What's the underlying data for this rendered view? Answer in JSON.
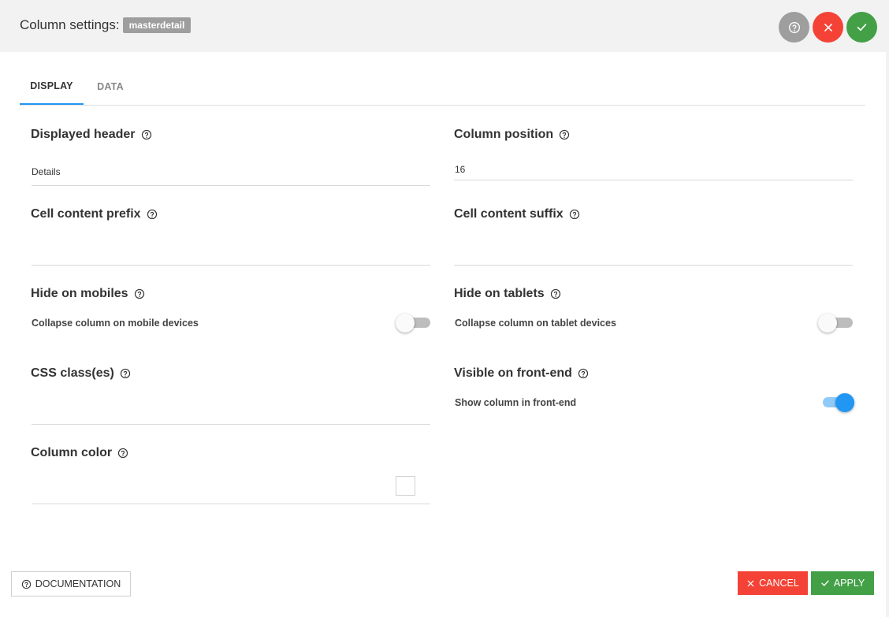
{
  "header": {
    "title": "Column settings:",
    "badge": "masterdetail",
    "help_icon": "help-circle-icon",
    "close_icon": "close-icon",
    "confirm_icon": "check-icon"
  },
  "tabs": [
    {
      "label": "DISPLAY",
      "active": true
    },
    {
      "label": "DATA",
      "active": false
    }
  ],
  "fields": {
    "displayed_header": {
      "label": "Displayed header",
      "value": "Details"
    },
    "column_position": {
      "label": "Column position",
      "value": "16"
    },
    "cell_prefix": {
      "label": "Cell content prefix",
      "value": ""
    },
    "cell_suffix": {
      "label": "Cell content suffix",
      "value": ""
    },
    "hide_mobiles": {
      "label": "Hide on mobiles",
      "sub_label": "Collapse column on mobile devices",
      "enabled": false
    },
    "hide_tablets": {
      "label": "Hide on tablets",
      "sub_label": "Collapse column on tablet devices",
      "enabled": false
    },
    "css_classes": {
      "label": "CSS class(es)",
      "value": ""
    },
    "visible_frontend": {
      "label": "Visible on front-end",
      "sub_label": "Show column in front-end",
      "enabled": true
    },
    "column_color": {
      "label": "Column color",
      "value": ""
    }
  },
  "footer": {
    "documentation_label": "DOCUMENTATION",
    "cancel_label": "CANCEL",
    "apply_label": "APPLY"
  },
  "colors": {
    "accent": "#2196f3",
    "danger": "#f44336",
    "success": "#43a047",
    "neutral": "#9e9e9e"
  }
}
